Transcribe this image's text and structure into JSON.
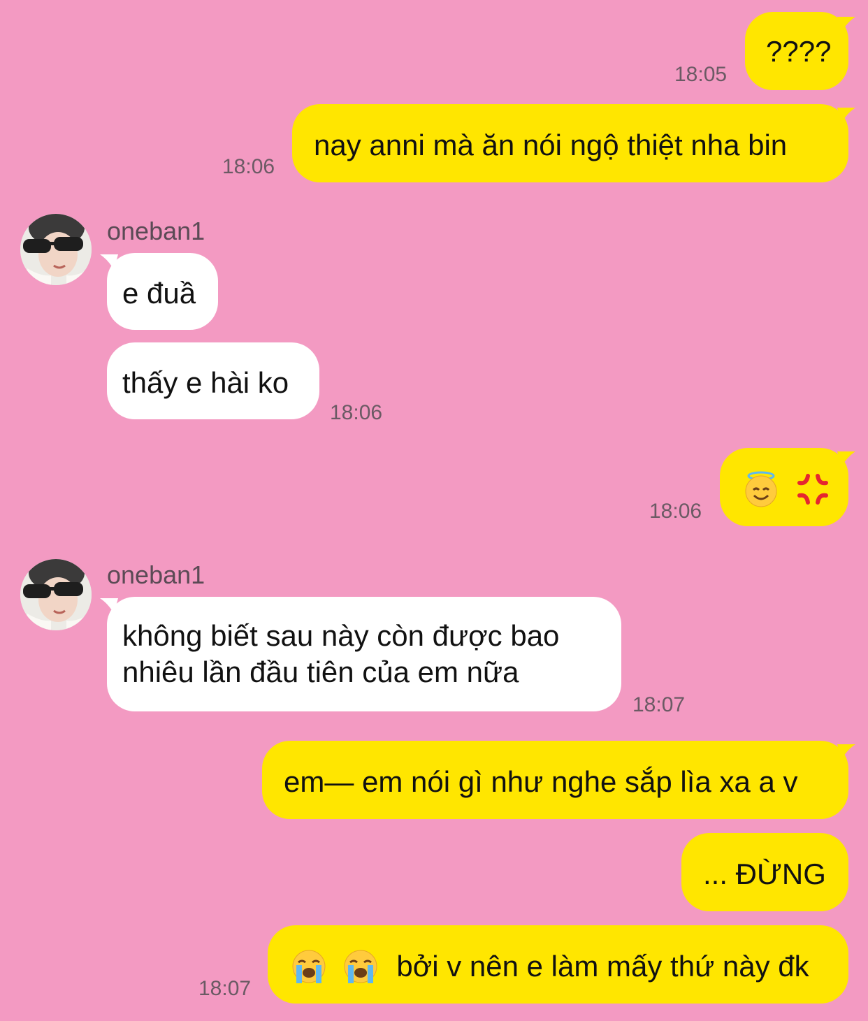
{
  "chat": {
    "contact_name": "oneban1",
    "messages": [
      {
        "id": "m1",
        "text": "????",
        "time": "18:05"
      },
      {
        "id": "m2",
        "text": "nay anni mà ăn nói ngộ thiệt nha bin",
        "time": "18:06"
      },
      {
        "id": "m3",
        "text": "e đuầ",
        "sender": "oneban1"
      },
      {
        "id": "m4",
        "text": "thấy e hài ko",
        "time": "18:06"
      },
      {
        "id": "m5",
        "emojis": [
          "innocent-smiling-halo-emoji",
          "anger-symbol-emoji"
        ],
        "time": "18:06"
      },
      {
        "id": "m6",
        "sender": "oneban1",
        "line1": "không biết sau này còn được bao",
        "line2": "nhiêu lần đầu tiên của em nữa",
        "time": "18:07"
      },
      {
        "id": "m7",
        "text": "em— em nói gì như nghe sắp lìa xa a v"
      },
      {
        "id": "m8",
        "text": "... ĐỪNG"
      },
      {
        "id": "m9",
        "emojis": [
          "loudly-crying-face-emoji",
          "loudly-crying-face-emoji"
        ],
        "text": "bởi v nên e làm mấy thứ này đk",
        "time": "18:07"
      }
    ]
  },
  "colors": {
    "background": "#f39ac2",
    "outgoing_bubble": "#ffe600",
    "incoming_bubble": "#ffffff"
  }
}
